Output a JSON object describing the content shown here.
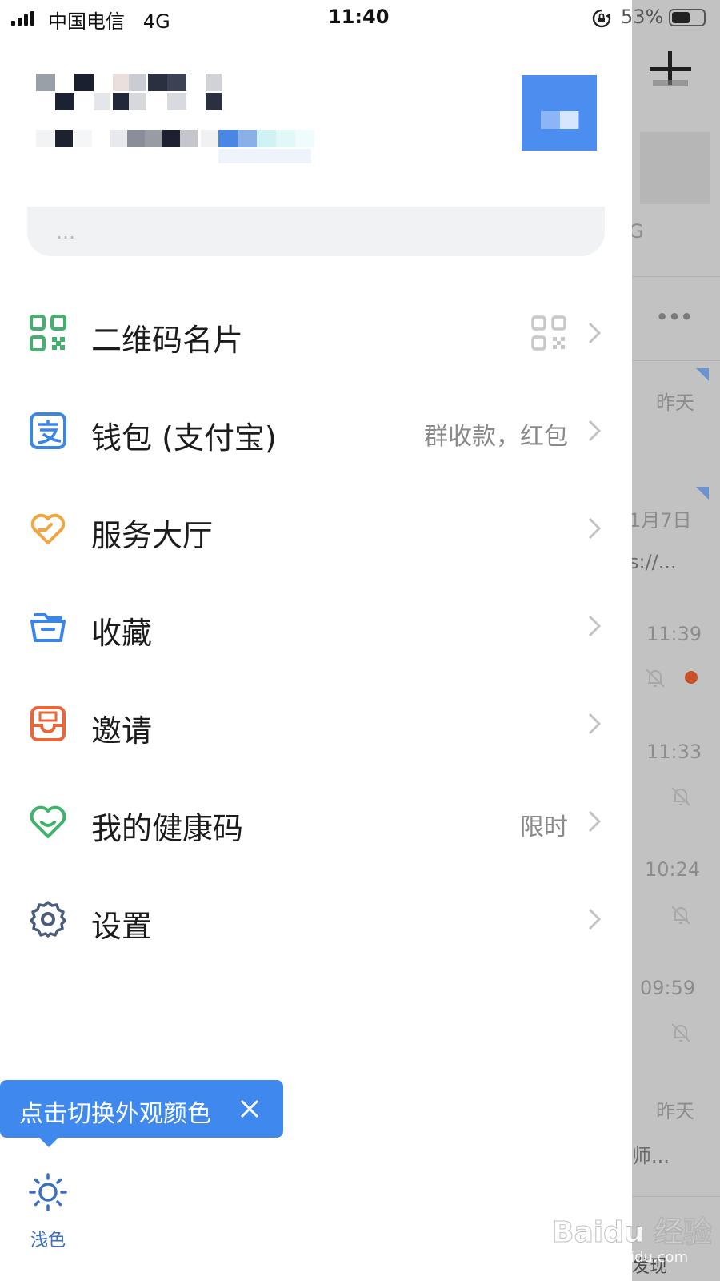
{
  "status_bar": {
    "carrier": "中国电信",
    "network": "4G",
    "time": "11:40",
    "battery": "53%"
  },
  "drawer": {
    "status_placeholder": "…",
    "menu": [
      {
        "label": "二维码名片",
        "extra": "",
        "icon": "qr-code-icon",
        "color": "#3fb36b"
      },
      {
        "label": "钱包 (支付宝)",
        "extra": "群收款，红包",
        "icon": "alipay-wallet-icon",
        "color": "#3a86e8"
      },
      {
        "label": "服务大厅",
        "extra": "",
        "icon": "heart-hands-icon",
        "color": "#f0a640"
      },
      {
        "label": "收藏",
        "extra": "",
        "icon": "favorites-box-icon",
        "color": "#3a86e8"
      },
      {
        "label": "邀请",
        "extra": "",
        "icon": "invite-mailbox-icon",
        "color": "#e8663a"
      },
      {
        "label": "我的健康码",
        "extra": "限时",
        "icon": "health-code-icon",
        "color": "#3fb36b"
      },
      {
        "label": "设置",
        "extra": "",
        "icon": "gear-icon",
        "color": "#4a5d7a"
      }
    ],
    "tooltip": "点击切换外观颜色",
    "theme_label": "浅色"
  },
  "background_list": {
    "times": [
      "昨天",
      "1月7日",
      "11:39",
      "11:33",
      "10:24",
      "09:59",
      "昨天"
    ],
    "snippets": [
      "s://...",
      "师..."
    ],
    "tab_label": "发现"
  },
  "watermark": {
    "main": "Baidu 经验",
    "sub": "jingyan.baidu.com"
  },
  "colors": {
    "accent": "#3f89ee",
    "dim_overlay": "#c2c2c2"
  }
}
